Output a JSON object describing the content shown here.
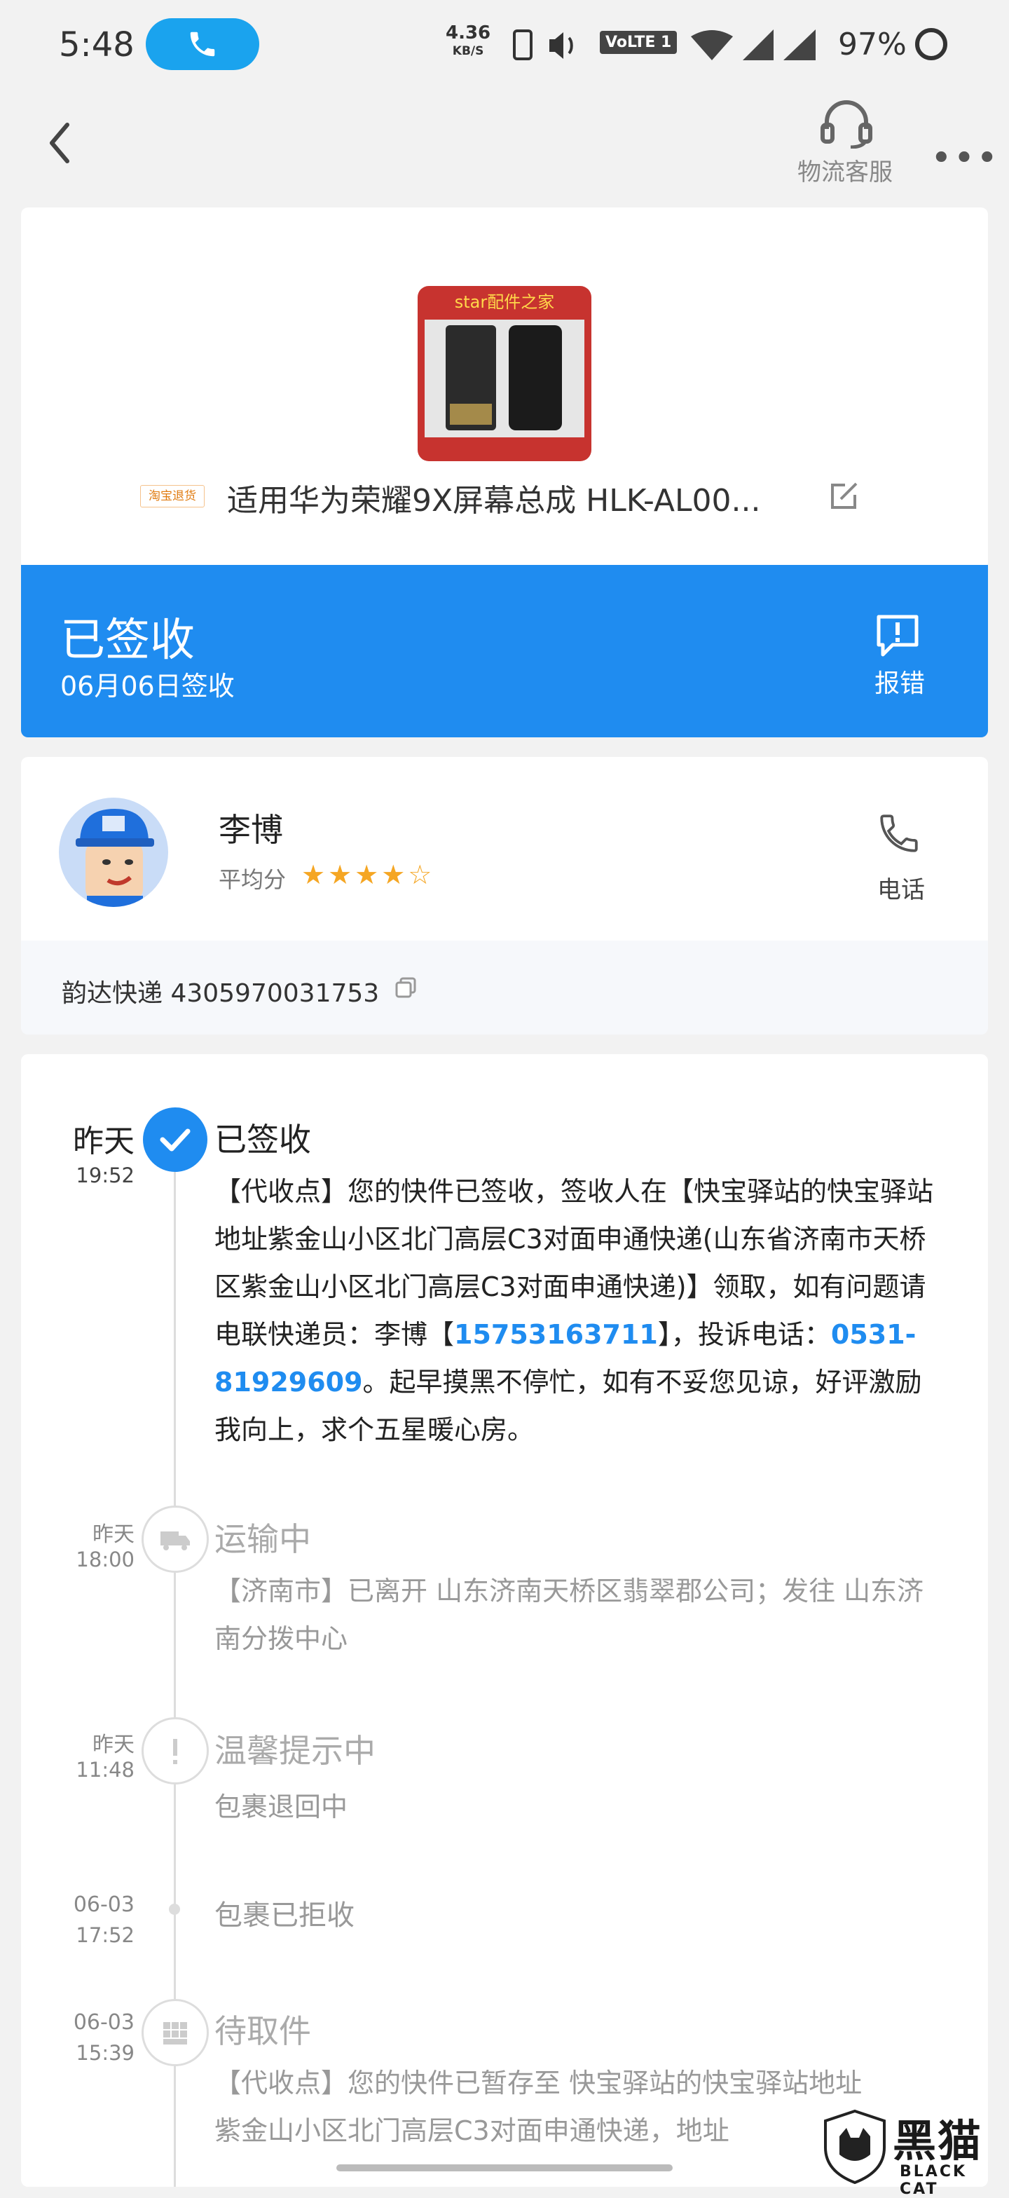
{
  "status_bar": {
    "time": "5:48",
    "net_speed": "4.36",
    "net_unit": "KB/S",
    "volte": "VoLTE 1",
    "battery": "97%"
  },
  "header": {
    "customer_service_label": "物流客服",
    "more_label": "•••"
  },
  "product": {
    "shop_badge": "star配件之家",
    "tag": "淘宝退货",
    "title": "适用华为荣耀9X屏幕总成 HLK-AL00..."
  },
  "status": {
    "title": "已签收",
    "date": "06月06日签收",
    "report_label": "报错",
    "color": "#1f8cf0"
  },
  "courier": {
    "name": "李博",
    "avg_label": "平均分",
    "rating": 4,
    "rating_max": 5,
    "stars_text": "★★★★☆",
    "call_label": "电话",
    "tracking": "韵达快递 4305970031753"
  },
  "timeline": [
    {
      "day": "昨天",
      "time": "19:52",
      "title": "已签收",
      "desc_parts": [
        "【代收点】您的快件已签收，签收人在【快宝驿站的快宝驿站地址紫金山小区北门高层C3对面申通快递(山东省济南市天桥区紫金山小区北门高层C3对面申通快递)】领取，如有问题请电联快递员：李博【",
        "15753163711",
        "】，投诉电话：",
        "0531-81929609",
        "。起早摸黑不停忙，如有不妥您见谅，好评激励我向上，求个五星暖心房。"
      ]
    },
    {
      "day": "昨天",
      "time": "18:00",
      "title": "运输中",
      "desc": "【济南市】已离开 山东济南天桥区翡翠郡公司；发往 山东济南分拨中心"
    },
    {
      "day": "昨天",
      "time": "11:48",
      "title": "温馨提示中",
      "desc": "包裹退回中"
    },
    {
      "day": "06-03",
      "time": "17:52",
      "title": "包裹已拒收"
    },
    {
      "day": "06-03",
      "time": "15:39",
      "title": "待取件",
      "desc": "【代收点】您的快件已暂存至 快宝驿站的快宝驿站地址紫金山小区北门高层C3对面申通快递，地址"
    }
  ],
  "watermark": {
    "title": "黑猫",
    "subtitle": "BLACK CAT"
  }
}
